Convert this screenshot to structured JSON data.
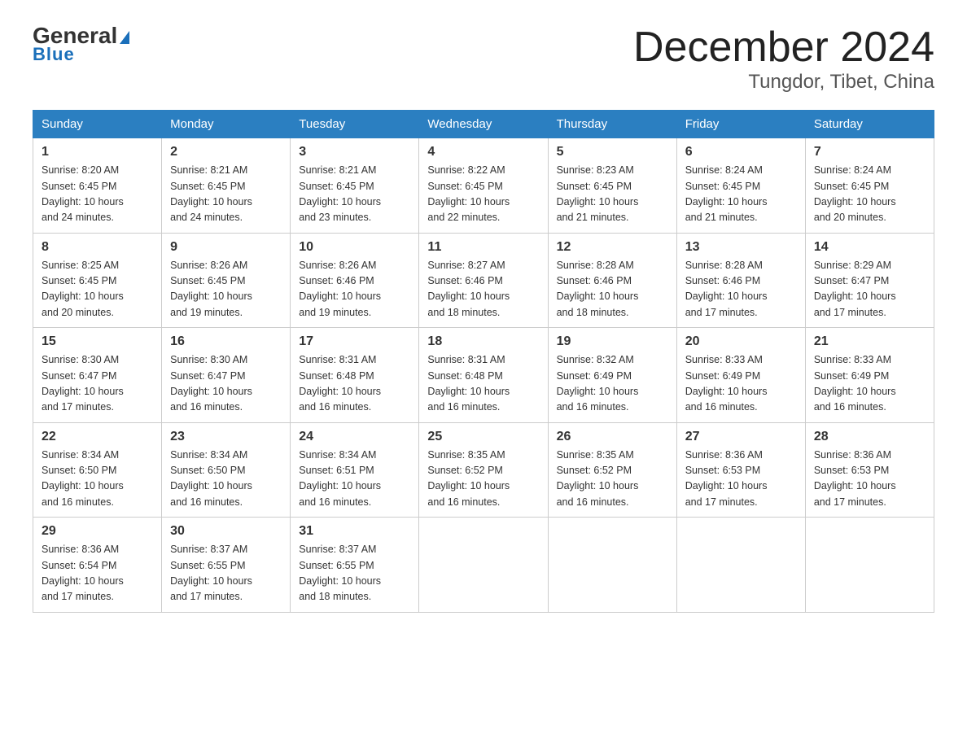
{
  "header": {
    "logo_general": "General",
    "logo_blue": "Blue",
    "title": "December 2024",
    "subtitle": "Tungdor, Tibet, China"
  },
  "days_of_week": [
    "Sunday",
    "Monday",
    "Tuesday",
    "Wednesday",
    "Thursday",
    "Friday",
    "Saturday"
  ],
  "weeks": [
    [
      {
        "day": "1",
        "sunrise": "8:20 AM",
        "sunset": "6:45 PM",
        "daylight": "10 hours and 24 minutes."
      },
      {
        "day": "2",
        "sunrise": "8:21 AM",
        "sunset": "6:45 PM",
        "daylight": "10 hours and 24 minutes."
      },
      {
        "day": "3",
        "sunrise": "8:21 AM",
        "sunset": "6:45 PM",
        "daylight": "10 hours and 23 minutes."
      },
      {
        "day": "4",
        "sunrise": "8:22 AM",
        "sunset": "6:45 PM",
        "daylight": "10 hours and 22 minutes."
      },
      {
        "day": "5",
        "sunrise": "8:23 AM",
        "sunset": "6:45 PM",
        "daylight": "10 hours and 21 minutes."
      },
      {
        "day": "6",
        "sunrise": "8:24 AM",
        "sunset": "6:45 PM",
        "daylight": "10 hours and 21 minutes."
      },
      {
        "day": "7",
        "sunrise": "8:24 AM",
        "sunset": "6:45 PM",
        "daylight": "10 hours and 20 minutes."
      }
    ],
    [
      {
        "day": "8",
        "sunrise": "8:25 AM",
        "sunset": "6:45 PM",
        "daylight": "10 hours and 20 minutes."
      },
      {
        "day": "9",
        "sunrise": "8:26 AM",
        "sunset": "6:45 PM",
        "daylight": "10 hours and 19 minutes."
      },
      {
        "day": "10",
        "sunrise": "8:26 AM",
        "sunset": "6:46 PM",
        "daylight": "10 hours and 19 minutes."
      },
      {
        "day": "11",
        "sunrise": "8:27 AM",
        "sunset": "6:46 PM",
        "daylight": "10 hours and 18 minutes."
      },
      {
        "day": "12",
        "sunrise": "8:28 AM",
        "sunset": "6:46 PM",
        "daylight": "10 hours and 18 minutes."
      },
      {
        "day": "13",
        "sunrise": "8:28 AM",
        "sunset": "6:46 PM",
        "daylight": "10 hours and 17 minutes."
      },
      {
        "day": "14",
        "sunrise": "8:29 AM",
        "sunset": "6:47 PM",
        "daylight": "10 hours and 17 minutes."
      }
    ],
    [
      {
        "day": "15",
        "sunrise": "8:30 AM",
        "sunset": "6:47 PM",
        "daylight": "10 hours and 17 minutes."
      },
      {
        "day": "16",
        "sunrise": "8:30 AM",
        "sunset": "6:47 PM",
        "daylight": "10 hours and 16 minutes."
      },
      {
        "day": "17",
        "sunrise": "8:31 AM",
        "sunset": "6:48 PM",
        "daylight": "10 hours and 16 minutes."
      },
      {
        "day": "18",
        "sunrise": "8:31 AM",
        "sunset": "6:48 PM",
        "daylight": "10 hours and 16 minutes."
      },
      {
        "day": "19",
        "sunrise": "8:32 AM",
        "sunset": "6:49 PM",
        "daylight": "10 hours and 16 minutes."
      },
      {
        "day": "20",
        "sunrise": "8:33 AM",
        "sunset": "6:49 PM",
        "daylight": "10 hours and 16 minutes."
      },
      {
        "day": "21",
        "sunrise": "8:33 AM",
        "sunset": "6:49 PM",
        "daylight": "10 hours and 16 minutes."
      }
    ],
    [
      {
        "day": "22",
        "sunrise": "8:34 AM",
        "sunset": "6:50 PM",
        "daylight": "10 hours and 16 minutes."
      },
      {
        "day": "23",
        "sunrise": "8:34 AM",
        "sunset": "6:50 PM",
        "daylight": "10 hours and 16 minutes."
      },
      {
        "day": "24",
        "sunrise": "8:34 AM",
        "sunset": "6:51 PM",
        "daylight": "10 hours and 16 minutes."
      },
      {
        "day": "25",
        "sunrise": "8:35 AM",
        "sunset": "6:52 PM",
        "daylight": "10 hours and 16 minutes."
      },
      {
        "day": "26",
        "sunrise": "8:35 AM",
        "sunset": "6:52 PM",
        "daylight": "10 hours and 16 minutes."
      },
      {
        "day": "27",
        "sunrise": "8:36 AM",
        "sunset": "6:53 PM",
        "daylight": "10 hours and 17 minutes."
      },
      {
        "day": "28",
        "sunrise": "8:36 AM",
        "sunset": "6:53 PM",
        "daylight": "10 hours and 17 minutes."
      }
    ],
    [
      {
        "day": "29",
        "sunrise": "8:36 AM",
        "sunset": "6:54 PM",
        "daylight": "10 hours and 17 minutes."
      },
      {
        "day": "30",
        "sunrise": "8:37 AM",
        "sunset": "6:55 PM",
        "daylight": "10 hours and 17 minutes."
      },
      {
        "day": "31",
        "sunrise": "8:37 AM",
        "sunset": "6:55 PM",
        "daylight": "10 hours and 18 minutes."
      },
      {
        "day": "",
        "sunrise": "",
        "sunset": "",
        "daylight": ""
      },
      {
        "day": "",
        "sunrise": "",
        "sunset": "",
        "daylight": ""
      },
      {
        "day": "",
        "sunrise": "",
        "sunset": "",
        "daylight": ""
      },
      {
        "day": "",
        "sunrise": "",
        "sunset": "",
        "daylight": ""
      }
    ]
  ],
  "labels": {
    "sunrise": "Sunrise:",
    "sunset": "Sunset:",
    "daylight": "Daylight:"
  }
}
